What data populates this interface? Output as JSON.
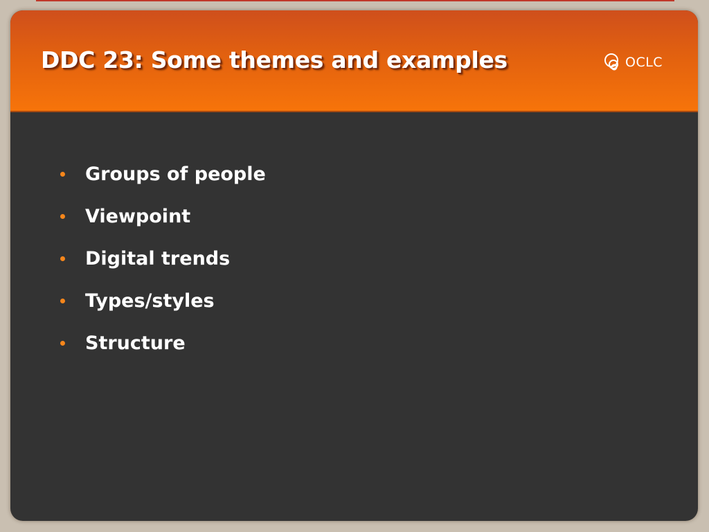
{
  "slide": {
    "title": "DDC 23: Some themes and examples",
    "logo": {
      "icon": "oclc-logo-icon",
      "text": "OCLC"
    },
    "bullets": [
      "Groups of people",
      "Viewpoint",
      "Digital trends",
      "Types/styles",
      "Structure"
    ]
  },
  "colors": {
    "header_gradient_top": "#cf4f1c",
    "header_gradient_bottom": "#f7740a",
    "body_background": "#333333",
    "bullet_color": "#f7861b",
    "text_color": "#ffffff",
    "page_background": "#c9bfb1"
  }
}
